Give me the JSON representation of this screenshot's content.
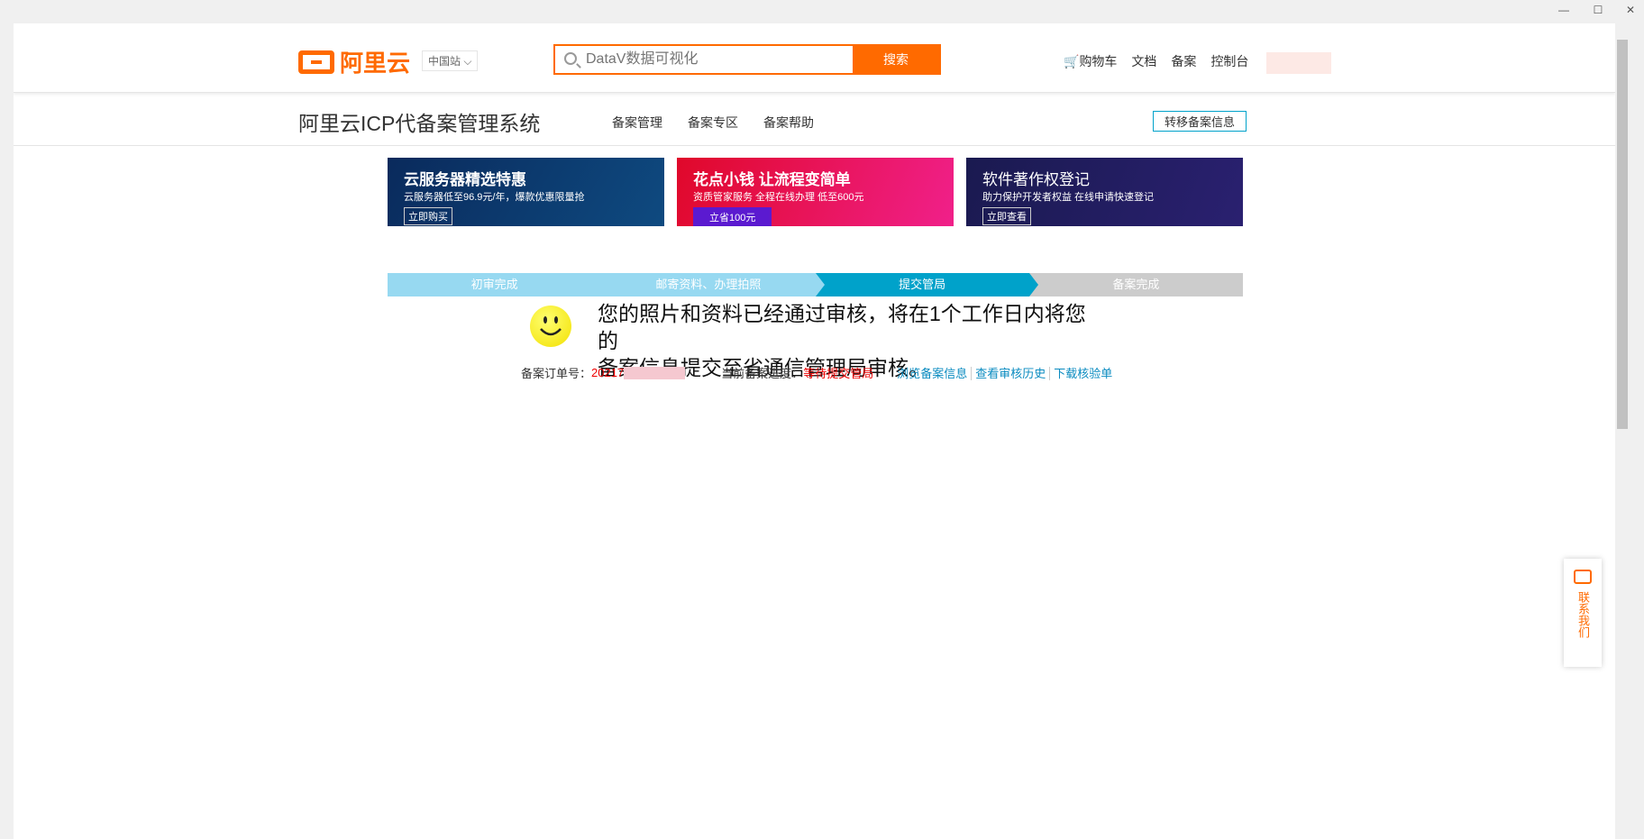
{
  "window": {
    "minimize": "—",
    "maximize": "☐",
    "close": "✕"
  },
  "header": {
    "logo": "阿里云",
    "region": "中国站",
    "search_placeholder": "DataV数据可视化",
    "search_button": "搜索",
    "links": [
      "购物车",
      "文档",
      "备案",
      "控制台"
    ]
  },
  "subnav": {
    "title": "阿里云ICP代备案管理系统",
    "items": [
      "备案管理",
      "备案专区",
      "备案帮助"
    ],
    "transfer_button": "转移备案信息"
  },
  "banners": [
    {
      "title": "云服务器精选特惠",
      "subtitle": "云服务器低至96.9元/年，爆款优惠限量抢",
      "button": "立即购买"
    },
    {
      "title": "花点小钱 让流程变简单",
      "subtitle": "资质管家服务 全程在线办理 低至600元",
      "button": "立省100元"
    },
    {
      "title": "软件著作权登记",
      "subtitle": "助力保护开发者权益 在线申请快速登记",
      "button": "立即查看"
    }
  ],
  "steps": [
    {
      "label": "初审完成",
      "state": "done"
    },
    {
      "label": "邮寄资料、办理拍照",
      "state": "done"
    },
    {
      "label": "提交管局",
      "state": "current"
    },
    {
      "label": "备案完成",
      "state": "todo"
    }
  ],
  "status": {
    "message_line1": "您的照片和资料已经通过审核，将在1个工作日内将您的",
    "message_line2": "备案信息提交至省通信管理局审核。",
    "order_label": "备案订单号：",
    "order_value": "20217",
    "progress_label": "当前备案进度：",
    "progress_value": "等待提交管局",
    "links": [
      "浏览备案信息",
      "查看审核历史",
      "下载核验单"
    ]
  },
  "contact": {
    "label": "联系我们"
  }
}
